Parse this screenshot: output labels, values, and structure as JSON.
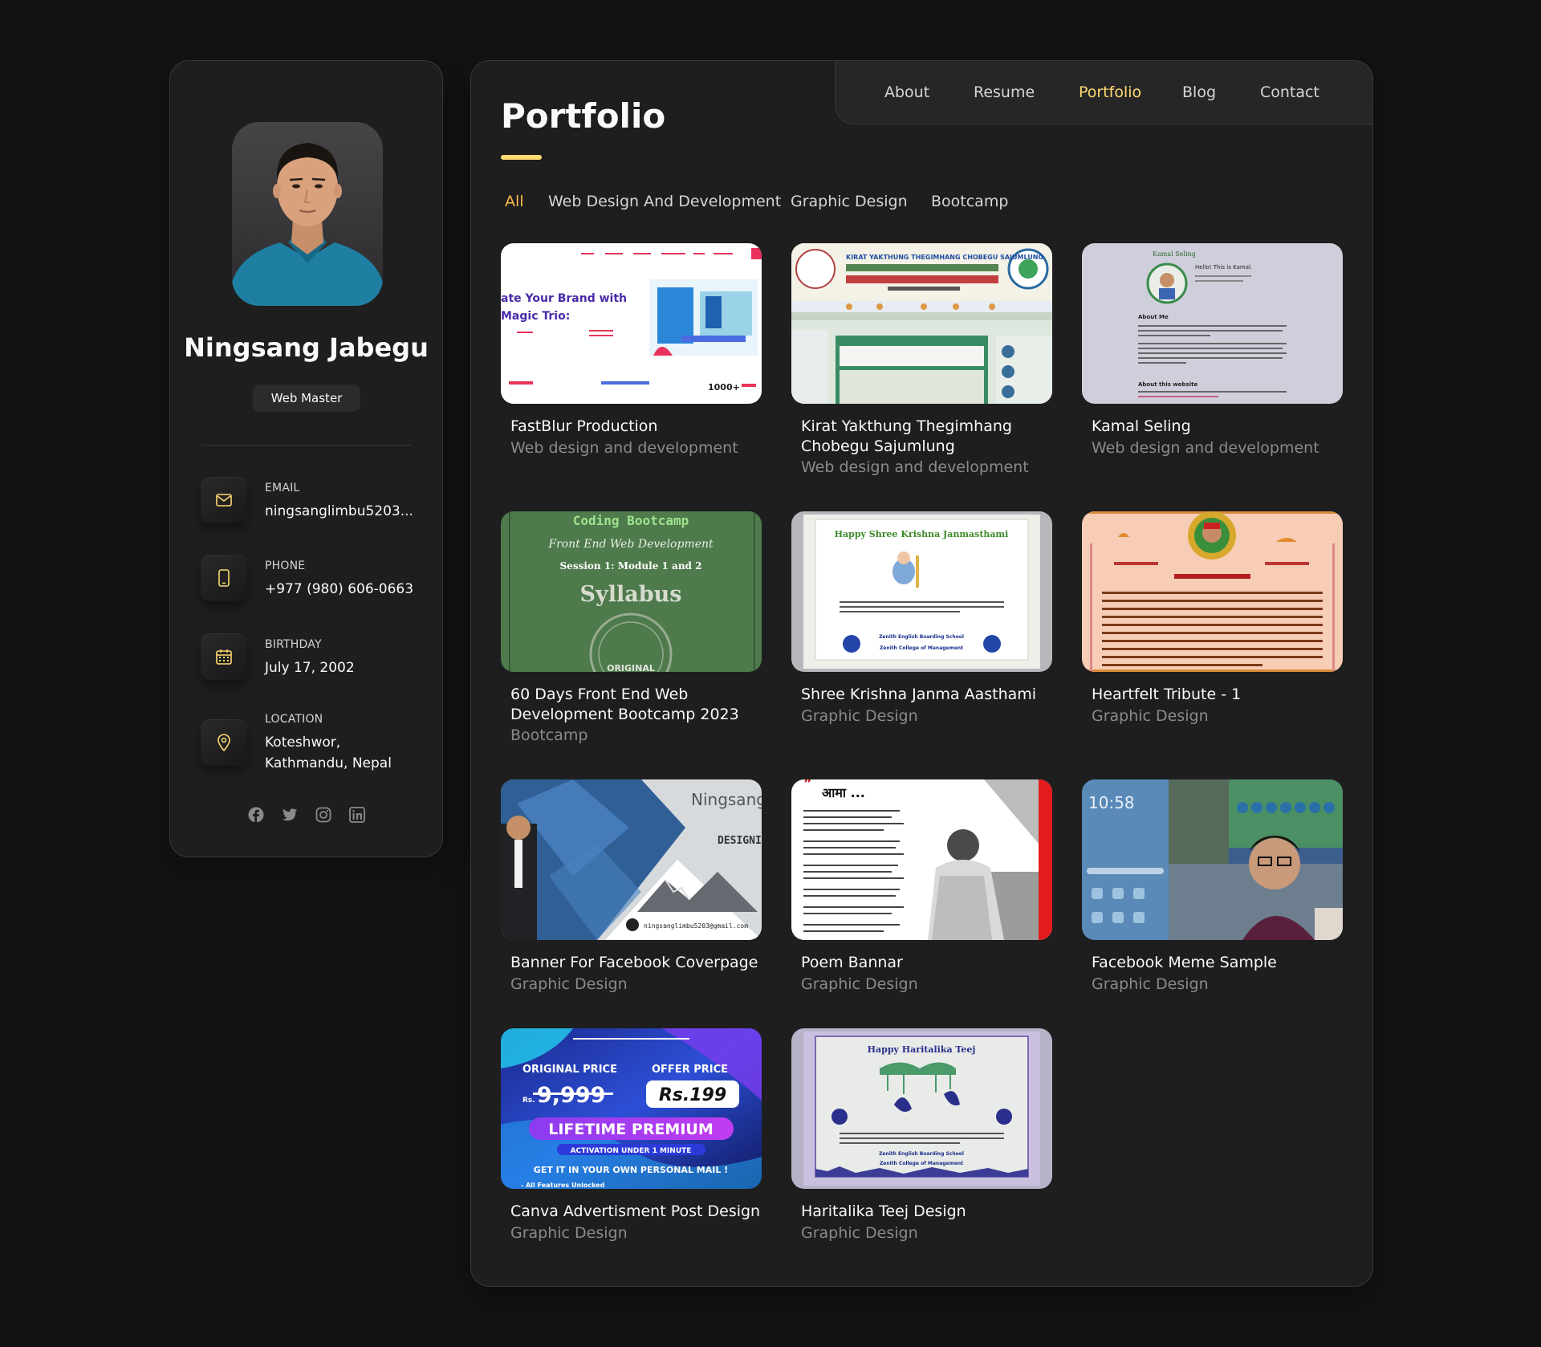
{
  "profile": {
    "name": "Ningsang Jabegu",
    "role": "Web Master",
    "contacts": [
      {
        "title": "Email",
        "value": "ningsanglimbu5203...",
        "icon": "mail-icon"
      },
      {
        "title": "Phone",
        "value": "+977 (980) 606-0663",
        "icon": "phone-icon"
      },
      {
        "title": "Birthday",
        "value": "July 17, 2002",
        "icon": "calendar-icon"
      },
      {
        "title": "Location",
        "value": "Koteshwor, Kathmandu, Nepal",
        "icon": "location-pin-icon"
      }
    ],
    "socials": [
      "facebook-icon",
      "twitter-icon",
      "instagram-icon",
      "linkedin-icon"
    ]
  },
  "nav": {
    "items": [
      "About",
      "Resume",
      "Portfolio",
      "Blog",
      "Contact"
    ],
    "active": "Portfolio"
  },
  "page_title": "Portfolio",
  "filters": {
    "items": [
      "All",
      "Web Design And Development",
      "Graphic Design",
      "Bootcamp"
    ],
    "active": "All"
  },
  "projects": [
    {
      "title": "FastBlur Production",
      "category": "Web design and development"
    },
    {
      "title": "Kirat Yakthung Thegimhang Chobegu Sajumlung",
      "category": "Web design and development"
    },
    {
      "title": "Kamal Seling",
      "category": "Web design and development"
    },
    {
      "title": "60 Days Front End Web Development Bootcamp 2023",
      "category": "Bootcamp"
    },
    {
      "title": "Shree Krishna Janma Aasthami",
      "category": "Graphic Design"
    },
    {
      "title": "Heartfelt Tribute - 1",
      "category": "Graphic Design"
    },
    {
      "title": "Banner For Facebook Coverpage",
      "category": "Graphic Design"
    },
    {
      "title": "Poem Bannar",
      "category": "Graphic Design"
    },
    {
      "title": "Facebook Meme Sample",
      "category": "Graphic Design"
    },
    {
      "title": "Canva Advertisment Post Design",
      "category": "Graphic Design"
    },
    {
      "title": "Haritalika Teej Design",
      "category": "Graphic Design"
    }
  ],
  "thumbnail_text": {
    "fastblur_headline_1": "ate Your Brand with",
    "fastblur_headline_2": "Magic Trio:",
    "fastblur_stat": "1000+",
    "kirat_header": "KIRAT YAKTHUNG THEGIMHANG CHOBEGU SAJUMLUNG",
    "kamal_name": "Kamal Seling",
    "kamal_hello": "Hello! This is Kamal.",
    "kamal_about": "About Me",
    "kamal_about_site": "About this website",
    "bootcamp_title": "Coding Bootcamp",
    "bootcamp_sub": "Front End Web Development",
    "bootcamp_session": "Session 1: Module 1 and 2",
    "bootcamp_syllabus": "Syllabus",
    "bootcamp_stamp": "ORIGINAL",
    "krishna_title": "Happy Shree Krishna Janmasthami",
    "school_1": "Zenith English Boarding School",
    "school_2": "Zenith College of Management",
    "banner_name": "Ningsang",
    "banner_tag": "DESIGNING AW",
    "banner_email": "ningsanglimbu5203@gmail.com",
    "poem_title": "आमा ...",
    "meme_time": "10:58",
    "canva_orig_label": "ORIGINAL PRICE",
    "canva_offer_label": "OFFER PRICE",
    "canva_orig_price": "9,999",
    "canva_rs": "Rs.",
    "canva_offer_price": "Rs.199",
    "canva_premium": "LIFETIME PREMIUM",
    "canva_activation": "ACTIVATION UNDER 1 MINUTE",
    "canva_cta": "GET IT IN YOUR OWN PERSONAL MAIL !",
    "canva_features": "- All Features Unlocked",
    "teej_title": "Happy Haritalika Teej"
  },
  "colors": {
    "background": "#121212",
    "panel": "#1e1e1f",
    "accent": "#ffdb70",
    "filter_active": "#ffb84d",
    "muted": "#8a8a8a"
  }
}
